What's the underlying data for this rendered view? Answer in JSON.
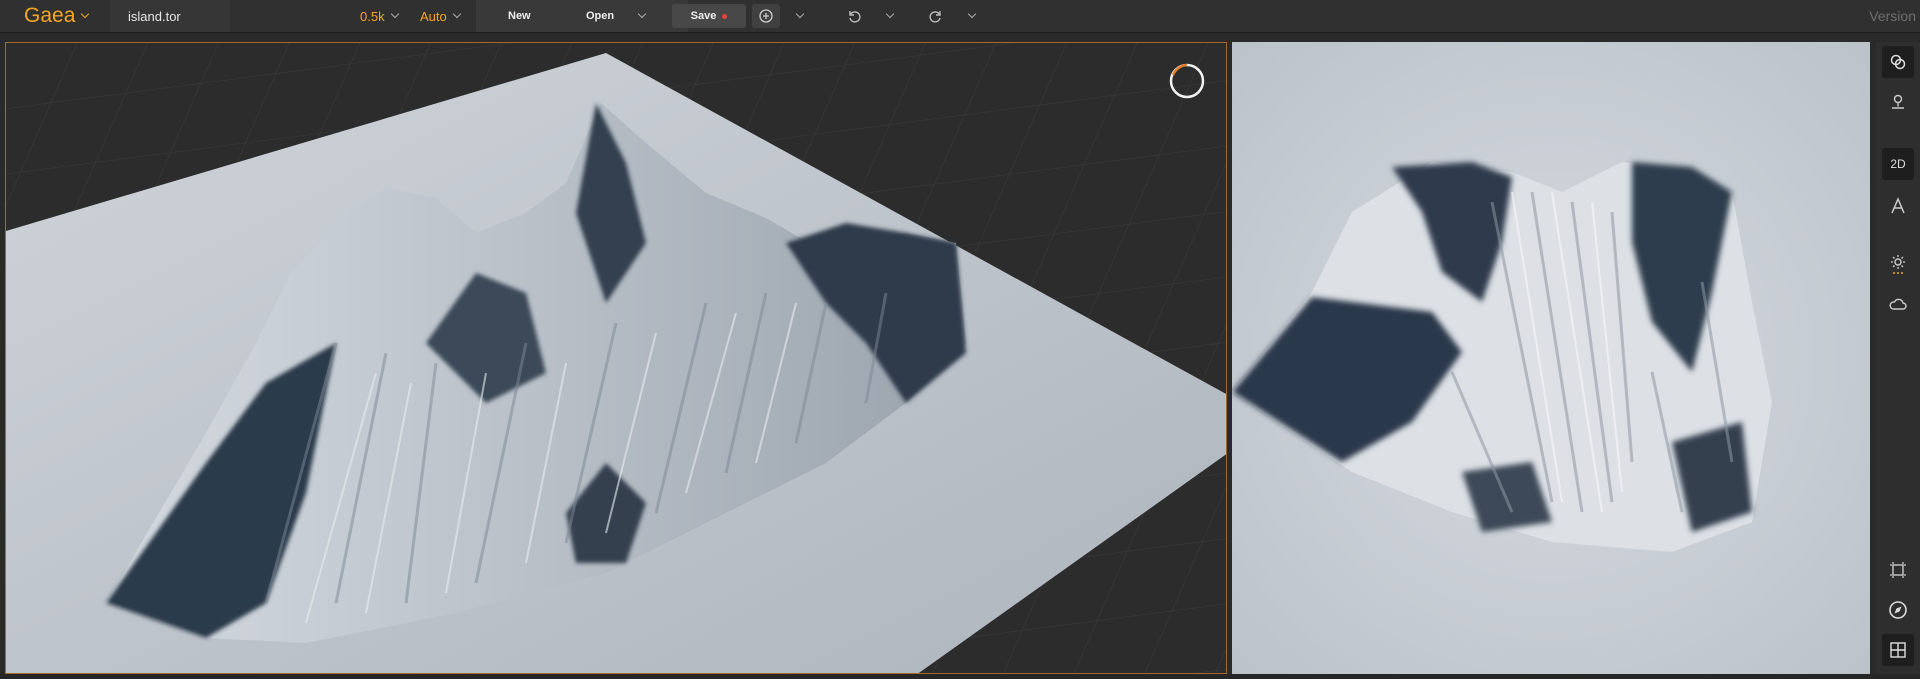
{
  "app": {
    "name": "Gaea",
    "file_name": "island.tor",
    "version_label": "Version"
  },
  "toolbar": {
    "resolution": "0.5k",
    "mode": "Auto",
    "new_label": "New",
    "open_label": "Open",
    "save_label": "Save",
    "save_unsaved_indicator": "unsaved-dot",
    "icons": [
      "plus-circle-icon",
      "undo-icon",
      "redo-icon"
    ]
  },
  "viewports": {
    "perspective": {
      "view": "3D",
      "status_icon": "loading-spinner-icon"
    },
    "top": {
      "view": "2D"
    }
  },
  "right_toolbar": {
    "items": [
      {
        "name": "link-nodes-icon",
        "active": true
      },
      {
        "name": "pin-icon",
        "active": false
      },
      {
        "name": "view-2d-toggle",
        "label": "2D",
        "active": true
      },
      {
        "name": "erosion-a-icon",
        "active": false
      },
      {
        "name": "sun-lighting-icon",
        "active": false
      },
      {
        "name": "cloud-icon",
        "active": false
      },
      {
        "name": "frame-select-icon",
        "active": false
      },
      {
        "name": "compass-icon",
        "active": false
      },
      {
        "name": "grid-layout-icon",
        "active": false
      }
    ]
  },
  "colors": {
    "accent": "#f5a623",
    "background": "#2a2a2a",
    "toolbar": "#303030",
    "viewport_border": "#a36a2a",
    "unsaved": "#e8443a"
  }
}
